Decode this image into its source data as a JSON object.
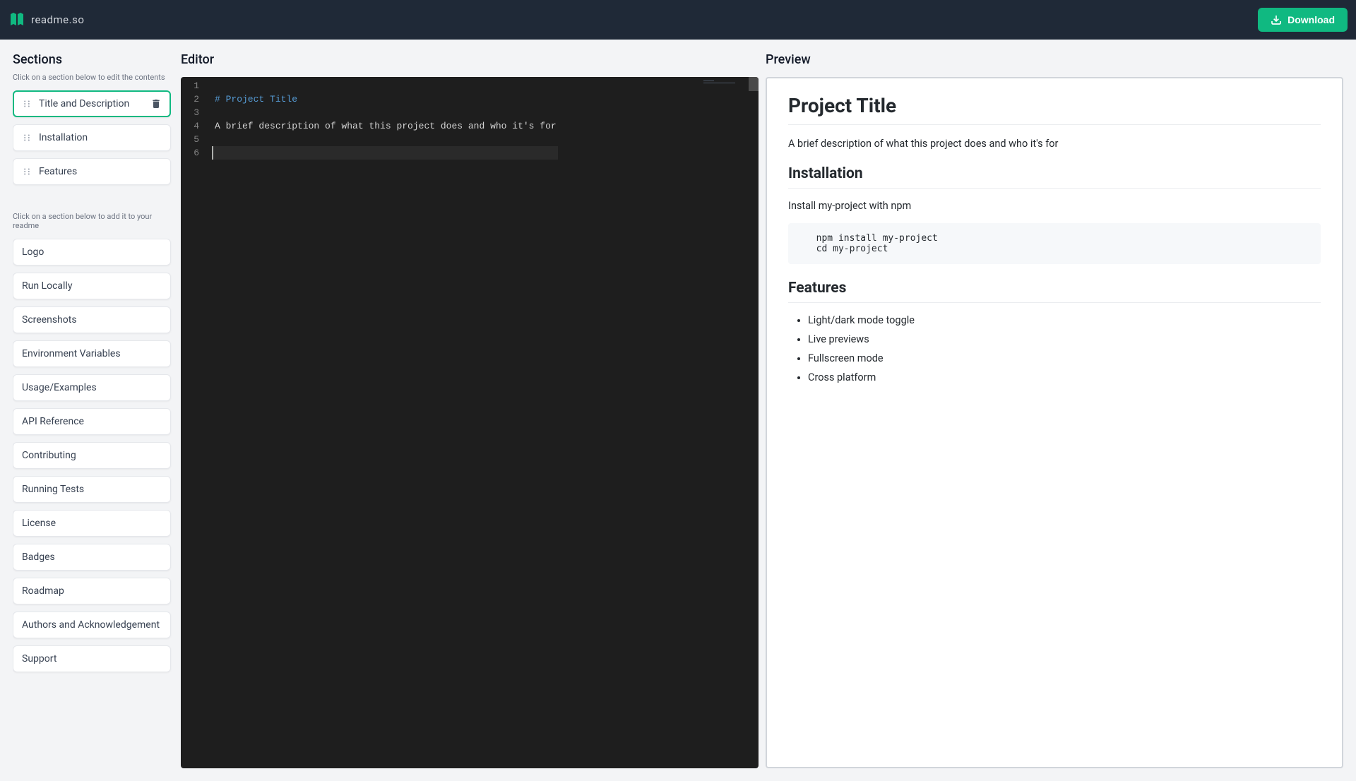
{
  "header": {
    "logo_text": "readme.so",
    "download_label": "Download"
  },
  "sidebar": {
    "title": "Sections",
    "edit_hint": "Click on a section below to edit the contents",
    "add_hint": "Click on a section below to add it to your readme",
    "selected_sections": [
      {
        "label": "Title and Description",
        "active": true
      },
      {
        "label": "Installation",
        "active": false
      },
      {
        "label": "Features",
        "active": false
      }
    ],
    "available_sections": [
      "Logo",
      "Run Locally",
      "Screenshots",
      "Environment Variables",
      "Usage/Examples",
      "API Reference",
      "Contributing",
      "Running Tests",
      "License",
      "Badges",
      "Roadmap",
      "Authors and Acknowledgement",
      "Support"
    ]
  },
  "editor": {
    "title": "Editor",
    "lines": [
      "",
      "# Project Title",
      "",
      "A brief description of what this project does and who it's for",
      "",
      ""
    ]
  },
  "preview": {
    "title": "Preview",
    "h1": "Project Title",
    "desc": "A brief description of what this project does and who it's for",
    "h2_install": "Installation",
    "install_text": "Install my-project with npm",
    "install_code": "  npm install my-project\n  cd my-project",
    "h2_features": "Features",
    "features": [
      "Light/dark mode toggle",
      "Live previews",
      "Fullscreen mode",
      "Cross platform"
    ]
  }
}
